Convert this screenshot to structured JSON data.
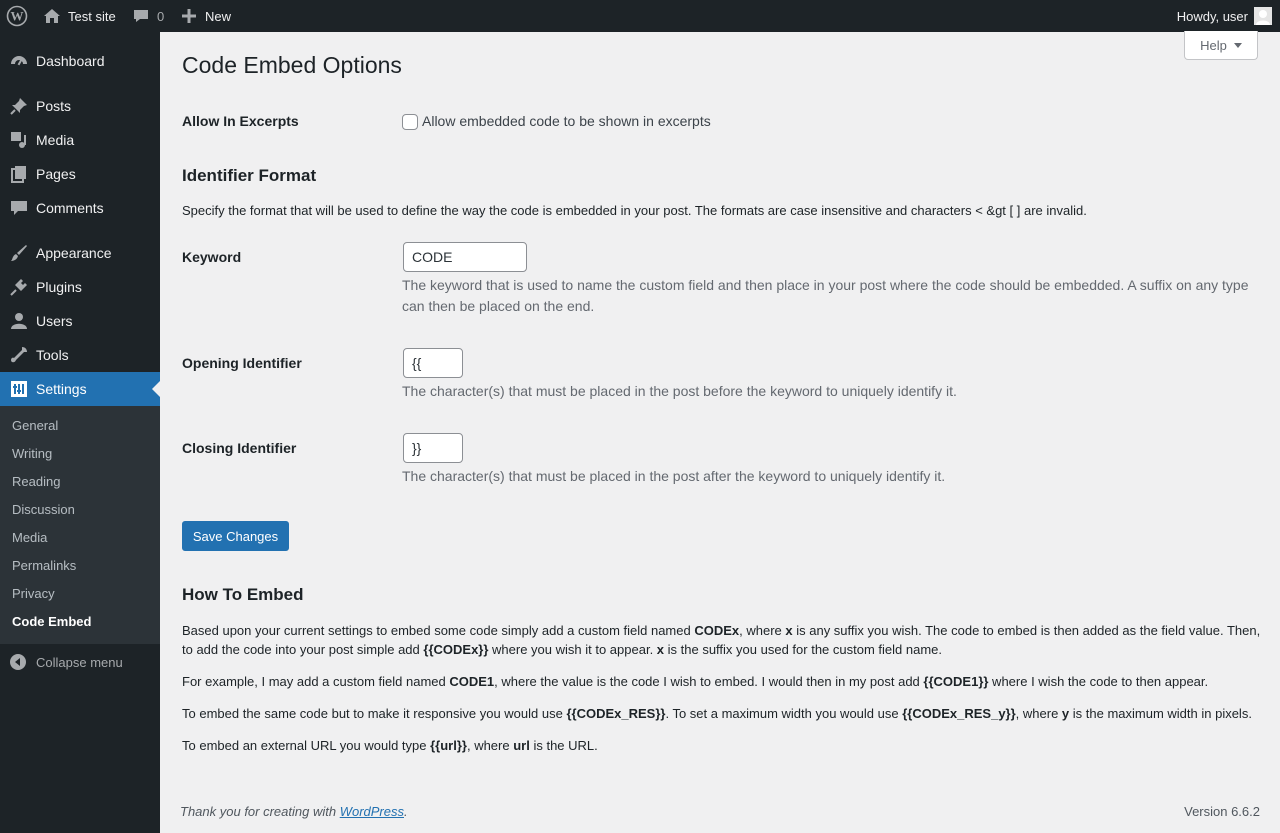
{
  "adminbar": {
    "site_name": "Test site",
    "comments_count": "0",
    "new_label": "New",
    "howdy": "Howdy, user"
  },
  "sidebar": {
    "items": [
      {
        "label": "Dashboard",
        "icon": "dashboard-icon"
      },
      {
        "label": "Posts",
        "icon": "pin-icon"
      },
      {
        "label": "Media",
        "icon": "media-icon"
      },
      {
        "label": "Pages",
        "icon": "pages-icon"
      },
      {
        "label": "Comments",
        "icon": "comment-icon"
      },
      {
        "label": "Appearance",
        "icon": "brush-icon"
      },
      {
        "label": "Plugins",
        "icon": "plug-icon"
      },
      {
        "label": "Users",
        "icon": "user-icon"
      },
      {
        "label": "Tools",
        "icon": "wrench-icon"
      },
      {
        "label": "Settings",
        "icon": "sliders-icon"
      }
    ],
    "submenu": [
      "General",
      "Writing",
      "Reading",
      "Discussion",
      "Media",
      "Permalinks",
      "Privacy",
      "Code Embed"
    ],
    "collapse_label": "Collapse menu"
  },
  "page": {
    "title": "Code Embed Options",
    "help_label": "Help",
    "excerpts": {
      "label": "Allow In Excerpts",
      "checkbox_label": "Allow embedded code to be shown in excerpts",
      "checked": false
    },
    "identifier": {
      "heading": "Identifier Format",
      "intro": "Specify the format that will be used to define the way the code is embedded in your post. The formats are case insensitive and characters < &gt [ ] are invalid."
    },
    "keyword": {
      "label": "Keyword",
      "value": "CODE",
      "description": "The keyword that is used to name the custom field and then place in your post where the code should be embedded. A suffix on any type can then be placed on the end."
    },
    "opening": {
      "label": "Opening Identifier",
      "value": "{{",
      "description": "The character(s) that must be placed in the post before the keyword to uniquely identify it."
    },
    "closing": {
      "label": "Closing Identifier",
      "value": "}}",
      "description": "The character(s) that must be placed in the post after the keyword to uniquely identify it."
    },
    "save_label": "Save Changes",
    "howto": {
      "heading": "How To Embed",
      "p1": {
        "a": "Based upon your current settings to embed some code simply add a custom field named ",
        "b1": "CODEx",
        "c": ", where ",
        "b2": "x",
        "d": " is any suffix you wish. The code to embed is then added as the field value. Then, to add the code into your post simple add ",
        "b3": "{{CODEx}}",
        "e": " where you wish it to appear. ",
        "b4": "x",
        "f": " is the suffix you used for the custom field name."
      },
      "p2": {
        "a": "For example, I may add a custom field named ",
        "b1": "CODE1",
        "c": ", where the value is the code I wish to embed. I would then in my post add ",
        "b2": "{{CODE1}}",
        "d": " where I wish the code to then appear."
      },
      "p3": {
        "a": "To embed the same code but to make it responsive you would use ",
        "b1": "{{CODEx_RES}}",
        "c": ". To set a maximum width you would use ",
        "b2": "{{CODEx_RES_y}}",
        "d": ", where ",
        "b3": "y",
        "e": " is the maximum width in pixels."
      },
      "p4": {
        "a": "To embed an external URL you would type ",
        "b1": "{{url}}",
        "c": ", where ",
        "b2": "url",
        "d": " is the URL."
      }
    }
  },
  "footer": {
    "thanks_prefix": "Thank you for creating with ",
    "thanks_link": "WordPress",
    "thanks_suffix": ".",
    "version": "Version 6.6.2"
  },
  "colors": {
    "accent": "#2271b1",
    "adminbar_bg": "#1d2327",
    "page_bg": "#f0f0f1"
  }
}
